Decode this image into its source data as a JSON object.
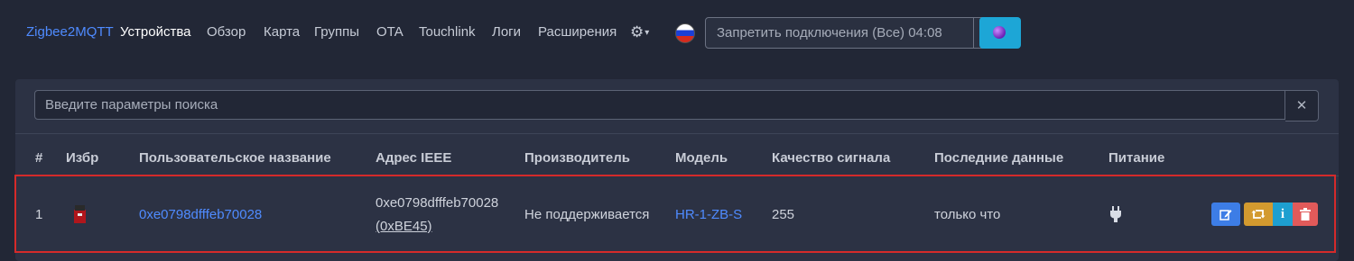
{
  "nav": {
    "brand": "Zigbee2MQTT",
    "links": [
      "Устройства",
      "Обзор",
      "Карта",
      "Группы",
      "OTA",
      "Touchlink",
      "Логи",
      "Расширения"
    ],
    "settings_icon": "gear-icon",
    "language_flag": "russia-flag-icon",
    "permit_join_label": "Запретить подключения (Все) 04:08",
    "permit_dropdown_icon": "chevron-down-icon",
    "coordinator_icon": "zigbee-dot-icon"
  },
  "search": {
    "placeholder": "Введите параметры поиска",
    "clear_icon": "close-icon"
  },
  "table": {
    "headers": [
      "#",
      "Избр",
      "Пользовательское название",
      "Адрес IEEE",
      "Производитель",
      "Модель",
      "Качество сигнала",
      "Последние данные",
      "Питание"
    ],
    "rows": [
      {
        "index": "1",
        "favorite_icon": "device-image-icon",
        "friendly_name": "0xe0798dfffeb70028",
        "ieee_address": "0xe0798dfffeb70028",
        "network_address": "(0xBE45)",
        "manufacturer": "Не поддерживается",
        "model": "HR-1-ZB-S",
        "lqi": "255",
        "last_seen": "только что",
        "power_icon": "plug-icon",
        "actions": [
          "edit-icon",
          "retweet-icon",
          "info-icon",
          "trash-icon"
        ]
      }
    ]
  },
  "colors": {
    "accent": "#4f8bff",
    "highlight": "#d52a2a",
    "edit": "#3d7de6",
    "swap": "#d39a2f",
    "info": "#1e9fd0",
    "delete": "#e15a5a"
  }
}
